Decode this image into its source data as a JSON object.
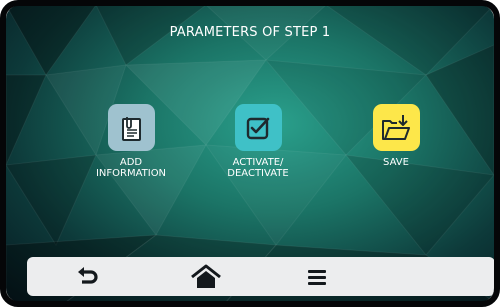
{
  "screen": {
    "title": "PARAMETERS OF STEP 1"
  },
  "actions": [
    {
      "id": "add-information",
      "label": "ADD INFORMATION",
      "label_lines": [
        "ADD",
        "INFORMATION"
      ],
      "icon": "clipboard-document-icon",
      "color": "#9fc2cf"
    },
    {
      "id": "activate-deactivate",
      "label": "ACTIVATE/ DEACTIVATE",
      "label_lines": [
        "ACTIVATE/",
        "DEACTIVATE"
      ],
      "icon": "checkbox-icon",
      "color": "#3fc1c7"
    },
    {
      "id": "save",
      "label": "SAVE",
      "label_lines": [
        "SAVE"
      ],
      "icon": "folder-download-icon",
      "color": "#fde74a"
    }
  ],
  "bottom_nav": [
    {
      "id": "back",
      "icon": "back-arrow-icon"
    },
    {
      "id": "home",
      "icon": "home-icon"
    },
    {
      "id": "menu",
      "icon": "hamburger-menu-icon"
    }
  ]
}
